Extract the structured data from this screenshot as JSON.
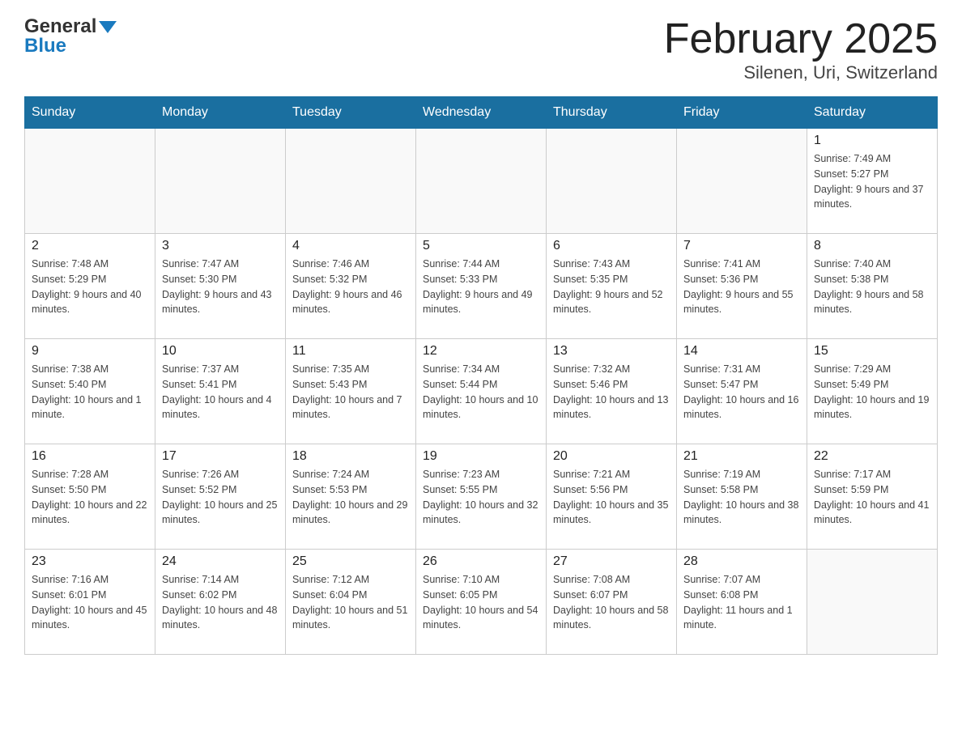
{
  "header": {
    "logo_line1": "General",
    "logo_line2": "Blue",
    "title": "February 2025",
    "subtitle": "Silenen, Uri, Switzerland"
  },
  "days_of_week": [
    "Sunday",
    "Monday",
    "Tuesday",
    "Wednesday",
    "Thursday",
    "Friday",
    "Saturday"
  ],
  "weeks": [
    [
      {
        "day": "",
        "info": ""
      },
      {
        "day": "",
        "info": ""
      },
      {
        "day": "",
        "info": ""
      },
      {
        "day": "",
        "info": ""
      },
      {
        "day": "",
        "info": ""
      },
      {
        "day": "",
        "info": ""
      },
      {
        "day": "1",
        "info": "Sunrise: 7:49 AM\nSunset: 5:27 PM\nDaylight: 9 hours and 37 minutes."
      }
    ],
    [
      {
        "day": "2",
        "info": "Sunrise: 7:48 AM\nSunset: 5:29 PM\nDaylight: 9 hours and 40 minutes."
      },
      {
        "day": "3",
        "info": "Sunrise: 7:47 AM\nSunset: 5:30 PM\nDaylight: 9 hours and 43 minutes."
      },
      {
        "day": "4",
        "info": "Sunrise: 7:46 AM\nSunset: 5:32 PM\nDaylight: 9 hours and 46 minutes."
      },
      {
        "day": "5",
        "info": "Sunrise: 7:44 AM\nSunset: 5:33 PM\nDaylight: 9 hours and 49 minutes."
      },
      {
        "day": "6",
        "info": "Sunrise: 7:43 AM\nSunset: 5:35 PM\nDaylight: 9 hours and 52 minutes."
      },
      {
        "day": "7",
        "info": "Sunrise: 7:41 AM\nSunset: 5:36 PM\nDaylight: 9 hours and 55 minutes."
      },
      {
        "day": "8",
        "info": "Sunrise: 7:40 AM\nSunset: 5:38 PM\nDaylight: 9 hours and 58 minutes."
      }
    ],
    [
      {
        "day": "9",
        "info": "Sunrise: 7:38 AM\nSunset: 5:40 PM\nDaylight: 10 hours and 1 minute."
      },
      {
        "day": "10",
        "info": "Sunrise: 7:37 AM\nSunset: 5:41 PM\nDaylight: 10 hours and 4 minutes."
      },
      {
        "day": "11",
        "info": "Sunrise: 7:35 AM\nSunset: 5:43 PM\nDaylight: 10 hours and 7 minutes."
      },
      {
        "day": "12",
        "info": "Sunrise: 7:34 AM\nSunset: 5:44 PM\nDaylight: 10 hours and 10 minutes."
      },
      {
        "day": "13",
        "info": "Sunrise: 7:32 AM\nSunset: 5:46 PM\nDaylight: 10 hours and 13 minutes."
      },
      {
        "day": "14",
        "info": "Sunrise: 7:31 AM\nSunset: 5:47 PM\nDaylight: 10 hours and 16 minutes."
      },
      {
        "day": "15",
        "info": "Sunrise: 7:29 AM\nSunset: 5:49 PM\nDaylight: 10 hours and 19 minutes."
      }
    ],
    [
      {
        "day": "16",
        "info": "Sunrise: 7:28 AM\nSunset: 5:50 PM\nDaylight: 10 hours and 22 minutes."
      },
      {
        "day": "17",
        "info": "Sunrise: 7:26 AM\nSunset: 5:52 PM\nDaylight: 10 hours and 25 minutes."
      },
      {
        "day": "18",
        "info": "Sunrise: 7:24 AM\nSunset: 5:53 PM\nDaylight: 10 hours and 29 minutes."
      },
      {
        "day": "19",
        "info": "Sunrise: 7:23 AM\nSunset: 5:55 PM\nDaylight: 10 hours and 32 minutes."
      },
      {
        "day": "20",
        "info": "Sunrise: 7:21 AM\nSunset: 5:56 PM\nDaylight: 10 hours and 35 minutes."
      },
      {
        "day": "21",
        "info": "Sunrise: 7:19 AM\nSunset: 5:58 PM\nDaylight: 10 hours and 38 minutes."
      },
      {
        "day": "22",
        "info": "Sunrise: 7:17 AM\nSunset: 5:59 PM\nDaylight: 10 hours and 41 minutes."
      }
    ],
    [
      {
        "day": "23",
        "info": "Sunrise: 7:16 AM\nSunset: 6:01 PM\nDaylight: 10 hours and 45 minutes."
      },
      {
        "day": "24",
        "info": "Sunrise: 7:14 AM\nSunset: 6:02 PM\nDaylight: 10 hours and 48 minutes."
      },
      {
        "day": "25",
        "info": "Sunrise: 7:12 AM\nSunset: 6:04 PM\nDaylight: 10 hours and 51 minutes."
      },
      {
        "day": "26",
        "info": "Sunrise: 7:10 AM\nSunset: 6:05 PM\nDaylight: 10 hours and 54 minutes."
      },
      {
        "day": "27",
        "info": "Sunrise: 7:08 AM\nSunset: 6:07 PM\nDaylight: 10 hours and 58 minutes."
      },
      {
        "day": "28",
        "info": "Sunrise: 7:07 AM\nSunset: 6:08 PM\nDaylight: 11 hours and 1 minute."
      },
      {
        "day": "",
        "info": ""
      }
    ]
  ]
}
